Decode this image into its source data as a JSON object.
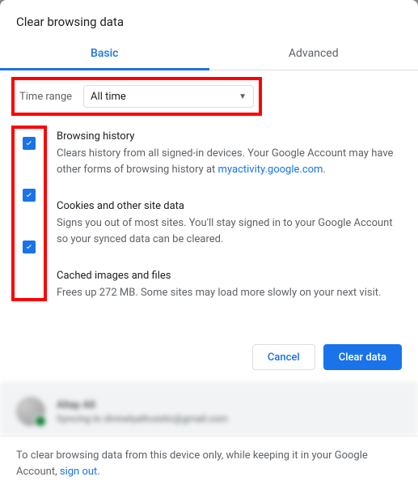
{
  "title": "Clear browsing data",
  "tabs": {
    "basic": "Basic",
    "advanced": "Advanced"
  },
  "timeRange": {
    "label": "Time range",
    "value": "All time"
  },
  "options": [
    {
      "title": "Browsing history",
      "desc_pre": "Clears history from all signed-in devices. Your Google Account may have other forms of browsing history at ",
      "link": "myactivity.google.com",
      "desc_post": "."
    },
    {
      "title": "Cookies and other site data",
      "desc": "Signs you out of most sites. You'll stay signed in to your Google Account so your synced data can be cleared."
    },
    {
      "title": "Cached images and files",
      "desc": "Frees up 272 MB. Some sites may load more slowly on your next visit."
    }
  ],
  "actions": {
    "cancel": "Cancel",
    "clear": "Clear data"
  },
  "account": {
    "name": "Altay Alt",
    "sync": "Syncing to divinelyaltruistic@gmail.com"
  },
  "footer": {
    "pre": "To clear browsing data from this device only, while keeping it in your Google Account, ",
    "link": "sign out",
    "post": "."
  }
}
